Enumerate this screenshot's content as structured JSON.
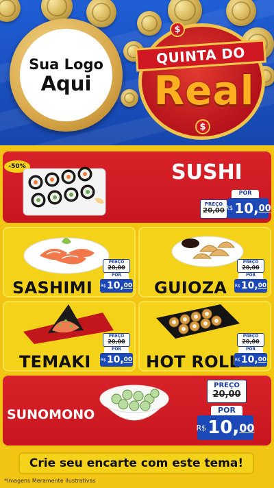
{
  "header": {
    "logo_line1": "Sua Logo",
    "logo_line2": "Aqui",
    "brand_top": "QUINTA DO",
    "brand_main": "Real",
    "dollar_symbol": "$"
  },
  "discount_badge": "-50%",
  "products": {
    "sushi": {
      "name": "SUSHI",
      "price_label": "PREÇO",
      "old_price": "20,00",
      "por_label": "POR",
      "currency": "R$",
      "new_int": "10",
      "new_cents": "00",
      "r_prefix": "R$"
    },
    "sashimi": {
      "name": "SASHIMI",
      "price_label": "PREÇO",
      "old_price": "20,00",
      "por_label": "POR",
      "currency": "R$",
      "new_int": "10",
      "new_cents": "00"
    },
    "guioza": {
      "name": "GUIOZA",
      "price_label": "PREÇO",
      "old_price": "20,00",
      "por_label": "POR",
      "currency": "R$",
      "new_int": "10",
      "new_cents": "00"
    },
    "temaki": {
      "name": "TEMAKI",
      "price_label": "PREÇO",
      "old_price": "20,00",
      "por_label": "POR",
      "currency": "R$",
      "new_int": "10",
      "new_cents": "00"
    },
    "hot_roll": {
      "name": "HOT ROLL",
      "price_label": "PREÇO",
      "old_price": "20,00",
      "por_label": "POR",
      "currency": "R$",
      "new_int": "10",
      "new_cents": "00"
    },
    "sunomono": {
      "name": "SUNOMONO",
      "price_label": "PREÇO",
      "old_price": "20,00",
      "por_label": "POR",
      "currency": "R$",
      "new_int": "10",
      "new_cents": "00"
    }
  },
  "cta": "Crie seu encarte com este tema!",
  "disclaimer": "*Imagens Meramente Ilustrativas",
  "colors": {
    "header_blue": "#1f5fd6",
    "panel_red": "#d8222a",
    "panel_yellow": "#f5d21a",
    "price_blue": "#1d49b8"
  }
}
